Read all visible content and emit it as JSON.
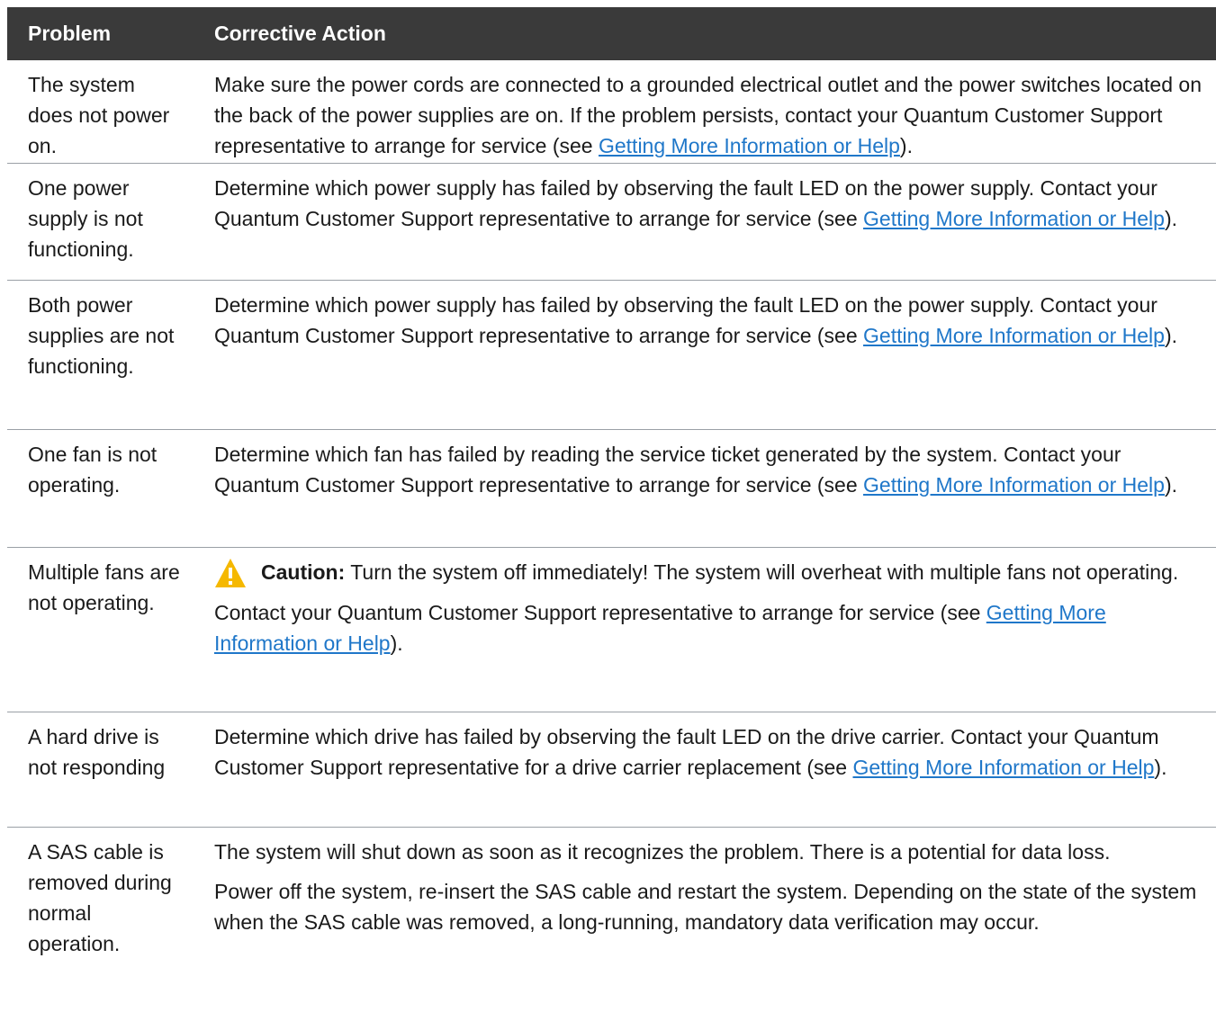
{
  "header": {
    "problem": "Problem",
    "action": "Corrective Action"
  },
  "link_text": "Getting More Information or Help",
  "rows": [
    {
      "problem": "The system does not power on.",
      "action_before": "Make sure the power cords are connected to a grounded electrical outlet and the power switches located on the back of the power supplies are on. If the problem persists, contact your Quantum Customer Support representative to arrange for service (see ",
      "action_after": ")."
    },
    {
      "problem": "One power supply is not functioning.",
      "action_before": "Determine which power supply has failed by observing the fault LED on the power supply. Contact your Quantum Customer Support representative to arrange for service (see ",
      "action_after": ")."
    },
    {
      "problem": "Both power supplies are not functioning.",
      "action_before": "Determine which power supply has failed by observing the fault LED on the power supply. Contact your Quantum Customer Support representative to arrange for service (see ",
      "action_after": ")."
    },
    {
      "problem": "One fan is not operating.",
      "action_before": "Determine which fan has failed by reading the service ticket generated by the system. Contact your Quantum Customer Support representative to arrange for service (see ",
      "action_after": ")."
    },
    {
      "problem": "Multiple fans are not operating.",
      "caution_label": "Caution:",
      "caution_text": " Turn the system off immediately! The system will overheat with multiple fans not operating.",
      "action_before": "Contact your Quantum Customer Support representative to arrange for service (see ",
      "action_after": ")."
    },
    {
      "problem": "A hard drive is not responding",
      "action_before": "Determine which drive has failed by observing the fault LED on the drive carrier. Contact your Quantum Customer Support representative for a drive carrier replacement (see ",
      "action_after": ")."
    },
    {
      "problem": "A SAS cable is removed during normal operation.",
      "action_para1": "The system will shut down as soon as it recognizes the problem. There is a potential for data loss.",
      "action_para2": "Power off the system, re-insert the SAS cable and restart the system. Depending on the state of the system when the SAS cable was removed, a long-running, mandatory data verification may occur."
    }
  ],
  "colors": {
    "header_bg": "#3a3a3a",
    "link": "#1f77c9",
    "divider": "#9aa0a6",
    "caution_yellow": "#f5b800"
  },
  "icons": {
    "caution": "warning-triangle-icon"
  }
}
